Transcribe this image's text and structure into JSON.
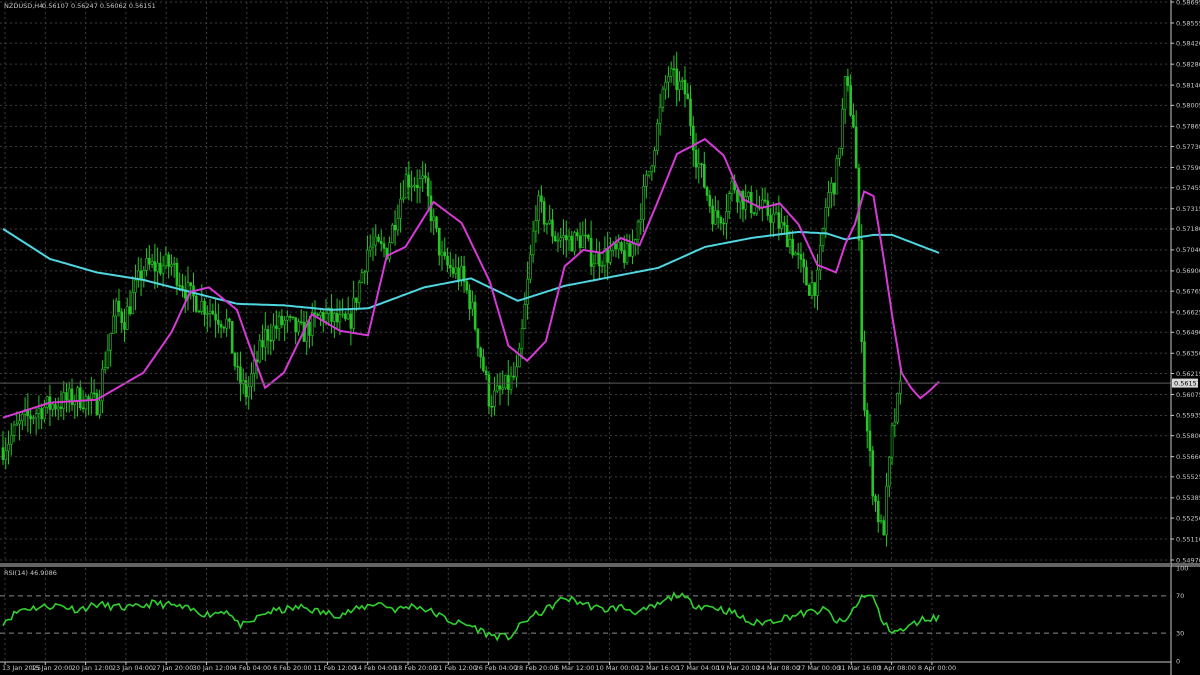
{
  "header": {
    "symbol": "NZDUSD,H4",
    "ohlc": "0.56107 0.56247 0.56062 0.56151"
  },
  "rsi_header": {
    "label": "RSI(14) 46.9086"
  },
  "current_price_label": "0.56151",
  "colors": {
    "background": "#000000",
    "grid": "#3c3c3c",
    "candles": "#27c527",
    "ma_fast": "#d63ad6",
    "ma_slow": "#4fd6e0",
    "rsi": "#2fd22f",
    "axis_text": "#c8c8c8"
  },
  "chart_data": [
    {
      "type": "candlestick",
      "symbol": "NZDUSD",
      "timeframe": "H4",
      "ylim": [
        0.5497,
        0.58695
      ],
      "price_ticks": [
        "0.58695",
        "0.58555",
        "0.58420",
        "0.58280",
        "0.58140",
        "0.58005",
        "0.57865",
        "0.57730",
        "0.57590",
        "0.57455",
        "0.57315",
        "0.57180",
        "0.57040",
        "0.56900",
        "0.56765",
        "0.56625",
        "0.56490",
        "0.56350",
        "0.56215",
        "0.56075",
        "0.55935",
        "0.55800",
        "0.55660",
        "0.55525",
        "0.55385",
        "0.55250",
        "0.55110",
        "0.54970"
      ],
      "last_price": 0.56151,
      "time_ticks": [
        "13 Jan 2025",
        "15 Jan 20:00",
        "20 Jan 12:00",
        "23 Jan 04:00",
        "27 Jan 20:00",
        "30 Jan 12:00",
        "4 Feb 04:00",
        "6 Feb 20:00",
        "11 Feb 12:00",
        "14 Feb 04:00",
        "18 Feb 20:00",
        "21 Feb 12:00",
        "26 Feb 04:00",
        "28 Feb 20:00",
        "5 Mar 12:00",
        "10 Mar 00:00",
        "12 Mar 16:00",
        "17 Mar 04:00",
        "19 Mar 20:00",
        "24 Mar 08:00",
        "27 Mar 00:00",
        "31 Mar 16:00",
        "3 Apr 08:00",
        "8 Apr 00:00"
      ],
      "close_path": {
        "x": [
          0.0,
          0.02,
          0.04,
          0.06,
          0.08,
          0.1,
          0.12,
          0.13,
          0.15,
          0.18,
          0.2,
          0.22,
          0.24,
          0.25,
          0.26,
          0.28,
          0.3,
          0.32,
          0.34,
          0.36,
          0.37,
          0.39,
          0.41,
          0.43,
          0.45,
          0.47,
          0.49,
          0.5,
          0.52,
          0.54,
          0.55,
          0.57,
          0.59,
          0.61,
          0.62,
          0.63,
          0.65,
          0.67,
          0.69,
          0.71,
          0.73,
          0.74,
          0.76,
          0.77,
          0.78,
          0.79,
          0.8,
          0.82,
          0.84,
          0.86,
          0.87,
          0.88,
          0.89,
          0.9,
          0.91,
          0.92,
          0.93,
          0.94,
          0.95,
          0.96,
          0.97,
          0.98,
          0.99,
          1.0
        ],
        "y": [
          0.5572,
          0.5589,
          0.5598,
          0.5602,
          0.5606,
          0.5601,
          0.5664,
          0.5658,
          0.5692,
          0.5694,
          0.5673,
          0.5665,
          0.5655,
          0.562,
          0.5608,
          0.5647,
          0.5656,
          0.5648,
          0.5661,
          0.5655,
          0.5654,
          0.5706,
          0.5704,
          0.5752,
          0.5748,
          0.5695,
          0.5686,
          0.5668,
          0.5603,
          0.5614,
          0.5622,
          0.5735,
          0.5713,
          0.571,
          0.5712,
          0.5698,
          0.5702,
          0.57,
          0.5756,
          0.5822,
          0.5808,
          0.5768,
          0.5725,
          0.5729,
          0.5749,
          0.5738,
          0.5734,
          0.5728,
          0.5712,
          0.568,
          0.5682,
          0.5738,
          0.5752,
          0.5816,
          0.5785,
          0.5603,
          0.5542,
          0.5512,
          0.5582,
          0.5615
        ],
        "note": "approximate"
      },
      "ma_fast": {
        "x": [
          0.0,
          0.05,
          0.1,
          0.15,
          0.18,
          0.2,
          0.22,
          0.25,
          0.26,
          0.28,
          0.3,
          0.33,
          0.36,
          0.39,
          0.41,
          0.43,
          0.46,
          0.49,
          0.52,
          0.54,
          0.56,
          0.58,
          0.6,
          0.62,
          0.64,
          0.66,
          0.68,
          0.7,
          0.72,
          0.75,
          0.77,
          0.79,
          0.81,
          0.83,
          0.85,
          0.87,
          0.89,
          0.9,
          0.91,
          0.92,
          0.93,
          0.94,
          0.95,
          0.96,
          0.97,
          0.98,
          0.99,
          1.0
        ],
        "y": [
          0.5592,
          0.5602,
          0.5604,
          0.5622,
          0.5649,
          0.5676,
          0.5679,
          0.5664,
          0.5646,
          0.5612,
          0.5622,
          0.5661,
          0.565,
          0.5647,
          0.57,
          0.5706,
          0.5736,
          0.5722,
          0.5683,
          0.564,
          0.563,
          0.5643,
          0.5693,
          0.5704,
          0.5702,
          0.5712,
          0.5707,
          0.5737,
          0.5768,
          0.5778,
          0.5767,
          0.5738,
          0.5732,
          0.5735,
          0.5721,
          0.5694,
          0.5689,
          0.5708,
          0.5721,
          0.5743,
          0.574,
          0.5702,
          0.566,
          0.5622,
          0.5612,
          0.5605,
          0.561,
          0.5616
        ],
        "note": "approximate"
      },
      "ma_slow": {
        "x": [
          0.0,
          0.05,
          0.1,
          0.15,
          0.2,
          0.25,
          0.3,
          0.35,
          0.39,
          0.45,
          0.5,
          0.55,
          0.6,
          0.65,
          0.7,
          0.75,
          0.8,
          0.85,
          0.88,
          0.9,
          0.93,
          0.95,
          1.0
        ],
        "y": [
          0.5718,
          0.5698,
          0.5689,
          0.5684,
          0.5676,
          0.5668,
          0.5667,
          0.5664,
          0.5665,
          0.5679,
          0.5685,
          0.567,
          0.568,
          0.5686,
          0.5692,
          0.5706,
          0.5712,
          0.5716,
          0.5715,
          0.5711,
          0.5714,
          0.5714,
          0.5702
        ],
        "note": "approximate"
      }
    },
    {
      "type": "line",
      "name": "RSI(14) 46.9086",
      "ylim": [
        0,
        100
      ],
      "levels": [
        30,
        70
      ],
      "tick_labels": [
        "100",
        "70",
        "30",
        "0"
      ],
      "x": [
        0.0,
        0.02,
        0.04,
        0.06,
        0.08,
        0.1,
        0.12,
        0.14,
        0.16,
        0.18,
        0.2,
        0.22,
        0.24,
        0.25,
        0.26,
        0.28,
        0.3,
        0.32,
        0.34,
        0.36,
        0.38,
        0.4,
        0.42,
        0.44,
        0.46,
        0.48,
        0.5,
        0.52,
        0.54,
        0.56,
        0.58,
        0.6,
        0.62,
        0.64,
        0.66,
        0.68,
        0.7,
        0.72,
        0.74,
        0.76,
        0.78,
        0.8,
        0.82,
        0.84,
        0.86,
        0.88,
        0.89,
        0.9,
        0.91,
        0.92,
        0.93,
        0.94,
        0.95,
        0.96,
        0.97,
        0.98,
        0.99,
        1.0
      ],
      "y": [
        42,
        56,
        58,
        60,
        55,
        61,
        58,
        57,
        62,
        60,
        55,
        50,
        55,
        40,
        38,
        52,
        55,
        58,
        52,
        50,
        56,
        63,
        55,
        60,
        52,
        42,
        38,
        28,
        25,
        45,
        55,
        68,
        62,
        55,
        58,
        52,
        60,
        72,
        60,
        58,
        52,
        40,
        43,
        48,
        52,
        55,
        42,
        42,
        58,
        72,
        68,
        40,
        33,
        32,
        38,
        44,
        46,
        47
      ],
      "note": "approximate"
    }
  ]
}
